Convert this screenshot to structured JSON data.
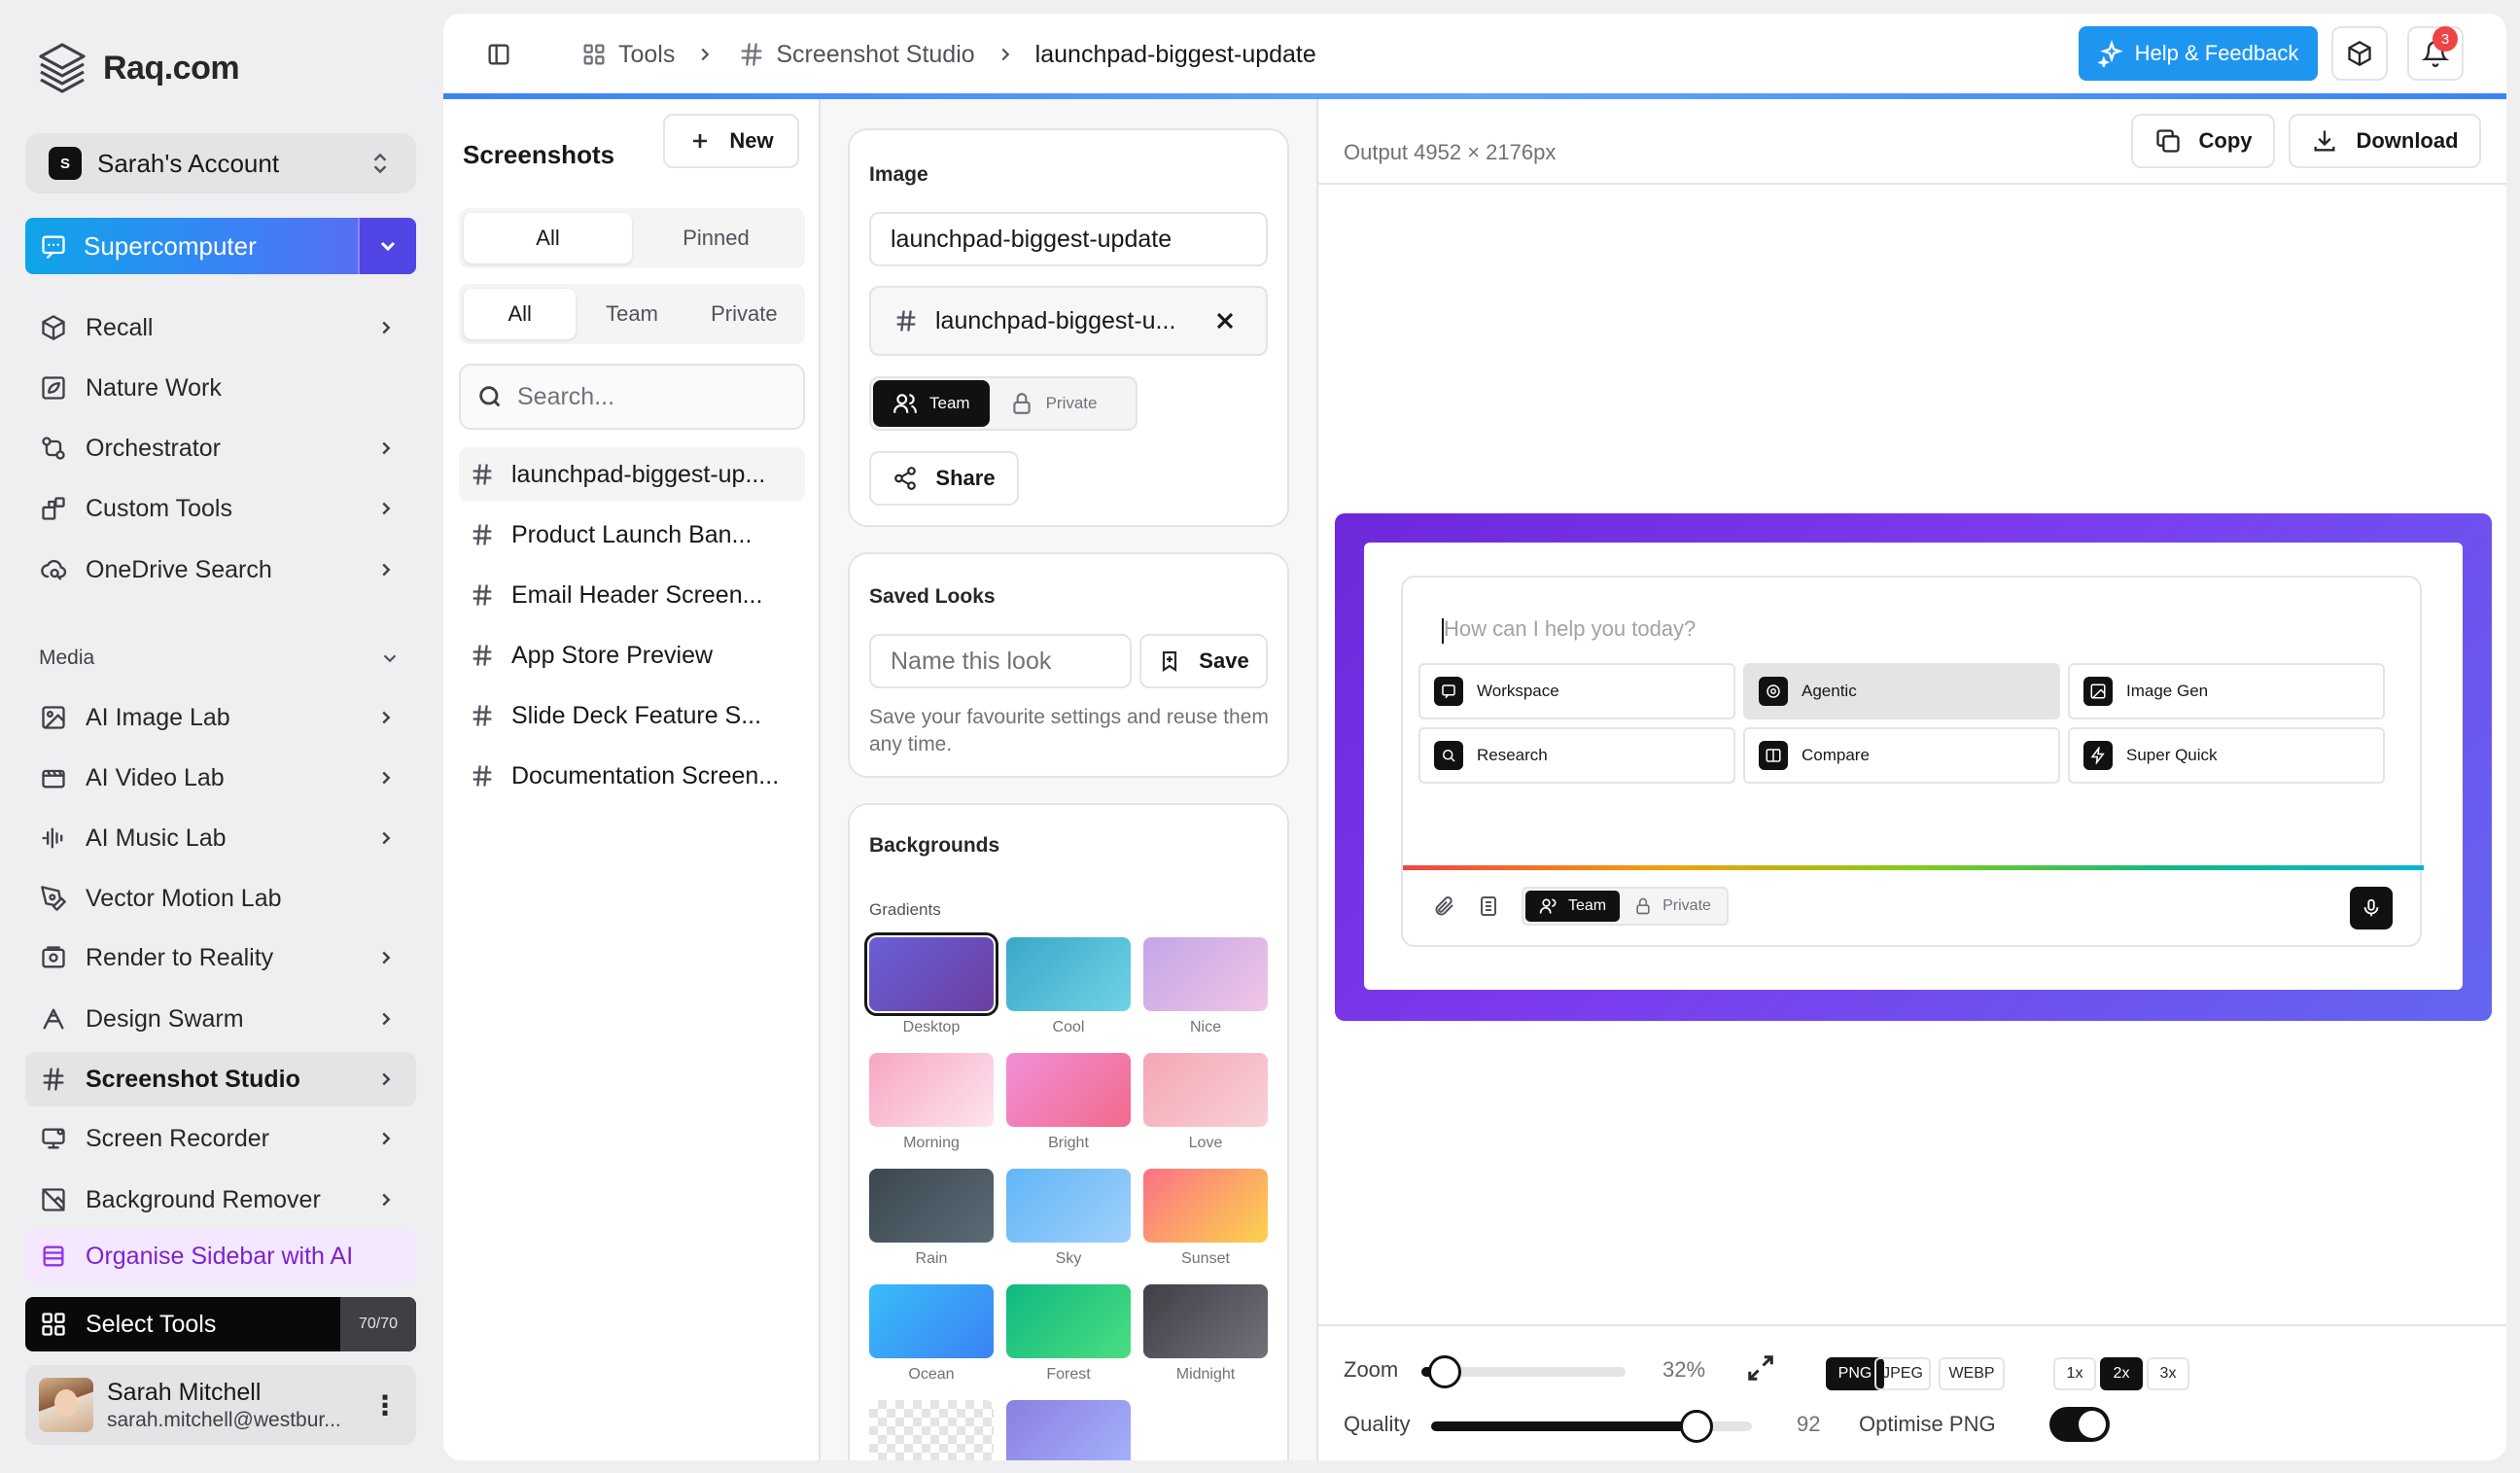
{
  "app": {
    "name": "Raq.com"
  },
  "account": {
    "initial": "S",
    "name": "Sarah's Account"
  },
  "supercomputer": {
    "label": "Supercomputer"
  },
  "nav": {
    "items": [
      {
        "label": "Recall",
        "icon": "cube-icon",
        "chevron": true
      },
      {
        "label": "Nature Work",
        "icon": "image-leaf-icon",
        "chevron": false
      },
      {
        "label": "Orchestrator",
        "icon": "workflow-icon",
        "chevron": true
      },
      {
        "label": "Custom Tools",
        "icon": "blocks-icon",
        "chevron": true
      },
      {
        "label": "OneDrive Search",
        "icon": "cloud-search-icon",
        "chevron": true
      }
    ],
    "media_section": "Media",
    "media_items": [
      {
        "label": "AI Image Lab",
        "icon": "image-icon",
        "chevron": true
      },
      {
        "label": "AI Video Lab",
        "icon": "video-icon",
        "chevron": true
      },
      {
        "label": "AI Music Lab",
        "icon": "audio-wave-icon",
        "chevron": true
      },
      {
        "label": "Vector Motion Lab",
        "icon": "pen-tool-icon",
        "chevron": false
      },
      {
        "label": "Render to Reality",
        "icon": "render-icon",
        "chevron": true
      },
      {
        "label": "Design Swarm",
        "icon": "swarm-icon",
        "chevron": true
      },
      {
        "label": "Screenshot Studio",
        "icon": "hash-icon",
        "chevron": true,
        "active": true
      },
      {
        "label": "Screen Recorder",
        "icon": "monitor-icon",
        "chevron": true
      },
      {
        "label": "Background Remover",
        "icon": "image-off-icon",
        "chevron": true
      }
    ],
    "organise": "Organise Sidebar with AI",
    "select_tools": {
      "label": "Select Tools",
      "count": "70/70"
    }
  },
  "user": {
    "name": "Sarah Mitchell",
    "email": "sarah.mitchell@westbur..."
  },
  "breadcrumb": {
    "tools": "Tools",
    "studio": "Screenshot Studio",
    "current": "launchpad-biggest-update"
  },
  "header": {
    "help": "Help & Feedback",
    "notifications": "3"
  },
  "screenshots": {
    "title": "Screenshots",
    "new_label": "New",
    "filter1": [
      "All",
      "Pinned"
    ],
    "filter2": [
      "All",
      "Team",
      "Private"
    ],
    "search_placeholder": "Search...",
    "items": [
      "launchpad-biggest-up...",
      "Product Launch Ban...",
      "Email Header Screen...",
      "App Store Preview",
      "Slide Deck Feature S...",
      "Documentation Screen..."
    ]
  },
  "image_card": {
    "title": "Image",
    "name_value": "launchpad-biggest-update",
    "chip": "launchpad-biggest-u...",
    "team": "Team",
    "private": "Private",
    "share": "Share"
  },
  "saved_looks": {
    "title": "Saved Looks",
    "placeholder": "Name this look",
    "save": "Save",
    "hint": "Save your favourite settings and reuse them any time."
  },
  "backgrounds": {
    "title": "Backgrounds",
    "gradients_label": "Gradients",
    "swatches": [
      {
        "name": "Desktop",
        "from": "#6a5fd8",
        "to": "#6b3fa0",
        "selected": true
      },
      {
        "name": "Cool",
        "from": "#3aa7c9",
        "to": "#6fd3e3"
      },
      {
        "name": "Nice",
        "from": "#c3a6e8",
        "to": "#f0c6e6"
      },
      {
        "name": "Morning",
        "from": "#f7a6c4",
        "to": "#fde4ef"
      },
      {
        "name": "Bright",
        "from": "#f08fd9",
        "to": "#f36a8a"
      },
      {
        "name": "Love",
        "from": "#f4a7b4",
        "to": "#f9d0d6"
      },
      {
        "name": "Rain",
        "from": "#3a4750",
        "to": "#5b6b76"
      },
      {
        "name": "Sky",
        "from": "#62b6f7",
        "to": "#9fd0fb"
      },
      {
        "name": "Sunset",
        "from": "#fb7185",
        "to": "#fcd34d"
      },
      {
        "name": "Ocean",
        "from": "#38bdf8",
        "to": "#3b82f6"
      },
      {
        "name": "Forest",
        "from": "#10b981",
        "to": "#4ade80"
      },
      {
        "name": "Midnight",
        "from": "#3f3f46",
        "to": "#71717a"
      }
    ]
  },
  "preview": {
    "output": "Output 4952 × 2176px",
    "copy": "Copy",
    "download": "Download",
    "placeholder": "How can I help you today?",
    "modes": [
      "Workspace",
      "Agentic",
      "Image Gen",
      "Research",
      "Compare",
      "Super Quick"
    ],
    "selected_mode": "Agentic",
    "team": "Team",
    "private": "Private"
  },
  "controls": {
    "zoom_label": "Zoom",
    "zoom_value": "32%",
    "zoom_fraction": 0.32,
    "quality_label": "Quality",
    "quality_value": "92",
    "quality_fraction": 0.92,
    "optimise_label": "Optimise PNG",
    "optimise_on": true,
    "formats": [
      "PNG",
      "JPEG",
      "WEBP"
    ],
    "format_selected": "PNG",
    "scales": [
      "1x",
      "2x",
      "3x"
    ],
    "scale_selected": "2x"
  }
}
